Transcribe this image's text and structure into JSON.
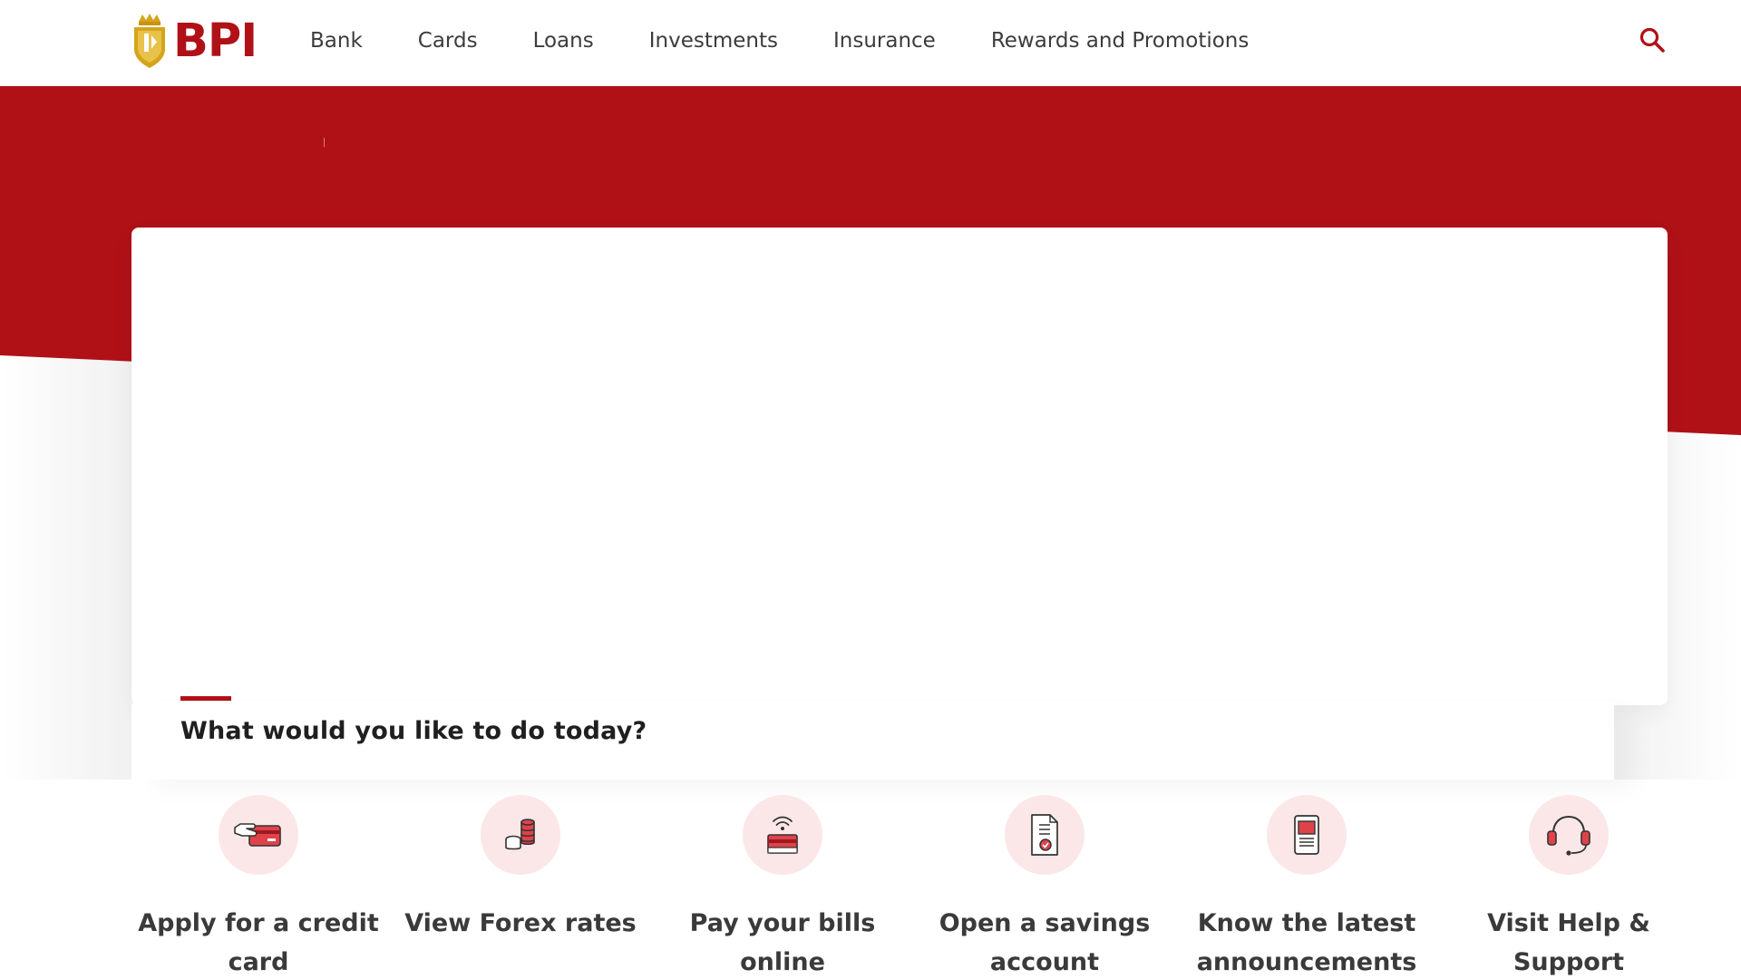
{
  "brand": {
    "name": "BPI",
    "color": "#b01117",
    "gold": "#d4a51c"
  },
  "nav": {
    "items": [
      {
        "label": "Bank"
      },
      {
        "label": "Cards"
      },
      {
        "label": "Loans"
      },
      {
        "label": "Investments"
      },
      {
        "label": "Insurance"
      },
      {
        "label": "Rewards and Promotions"
      }
    ],
    "search_icon": "search-icon"
  },
  "section": {
    "title": "What would you like to do today?"
  },
  "actions": [
    {
      "label": "Apply for a credit card",
      "icon": "credit-card-hand-icon"
    },
    {
      "label": "View Forex rates",
      "icon": "coin-stack-icon"
    },
    {
      "label": "Pay your bills online",
      "icon": "online-payment-icon"
    },
    {
      "label": "Open a savings account",
      "icon": "savings-document-icon"
    },
    {
      "label": "Know the latest announcements",
      "icon": "mobile-news-icon"
    },
    {
      "label": "Visit Help & Support",
      "icon": "headset-icon"
    }
  ],
  "colors": {
    "hero": "#b01117",
    "icon_bg": "#fbe7e7",
    "text": "#3a3a3a"
  }
}
